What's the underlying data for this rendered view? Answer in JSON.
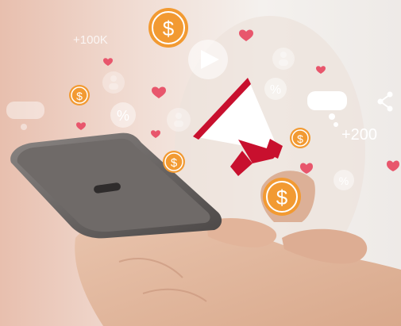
{
  "overlay_labels": {
    "count_small": "+100K",
    "count_large": "+200"
  },
  "icons": {
    "coin": "dollar-coin-icon",
    "heart": "heart-icon",
    "play": "play-icon",
    "user": "user-icon",
    "percent": "percent-icon",
    "chat": "chat-bubble-icon",
    "share": "share-icon",
    "megaphone": "megaphone-icon",
    "phone": "smartphone",
    "hand": "hand"
  },
  "colors": {
    "coin": "#f29a32",
    "heart": "#e8566c",
    "megaphone_red": "#c8102e",
    "icon_white": "#ffffff",
    "background_left": "#e8bfae",
    "background_right": "#eeeae7"
  }
}
